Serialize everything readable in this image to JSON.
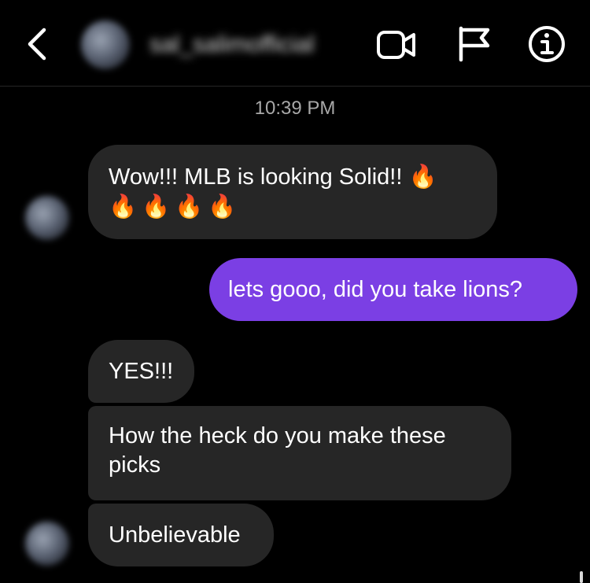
{
  "header": {
    "username": "sal_salimofficial",
    "icons": {
      "back": "chevron-left-icon",
      "video": "video-camera-icon",
      "flag": "flag-icon",
      "info": "info-icon"
    }
  },
  "thread": {
    "timestamp": "10:39 PM",
    "messages": [
      {
        "from": "them",
        "text": "Wow!!! MLB is looking Solid!!",
        "emoji": "🔥",
        "emoji_line": "🔥🔥🔥🔥"
      },
      {
        "from": "me",
        "text": "lets gooo, did you take lions?"
      },
      {
        "from": "them",
        "text": "YES!!!"
      },
      {
        "from": "them",
        "text": "How the heck do you make these\npicks"
      },
      {
        "from": "them",
        "text": "Unbelievable"
      }
    ]
  },
  "colors": {
    "background": "#000000",
    "incoming_bubble": "#262626",
    "outgoing_bubble": "#7b3fe4",
    "timestamp_text": "#a8a8a8"
  }
}
